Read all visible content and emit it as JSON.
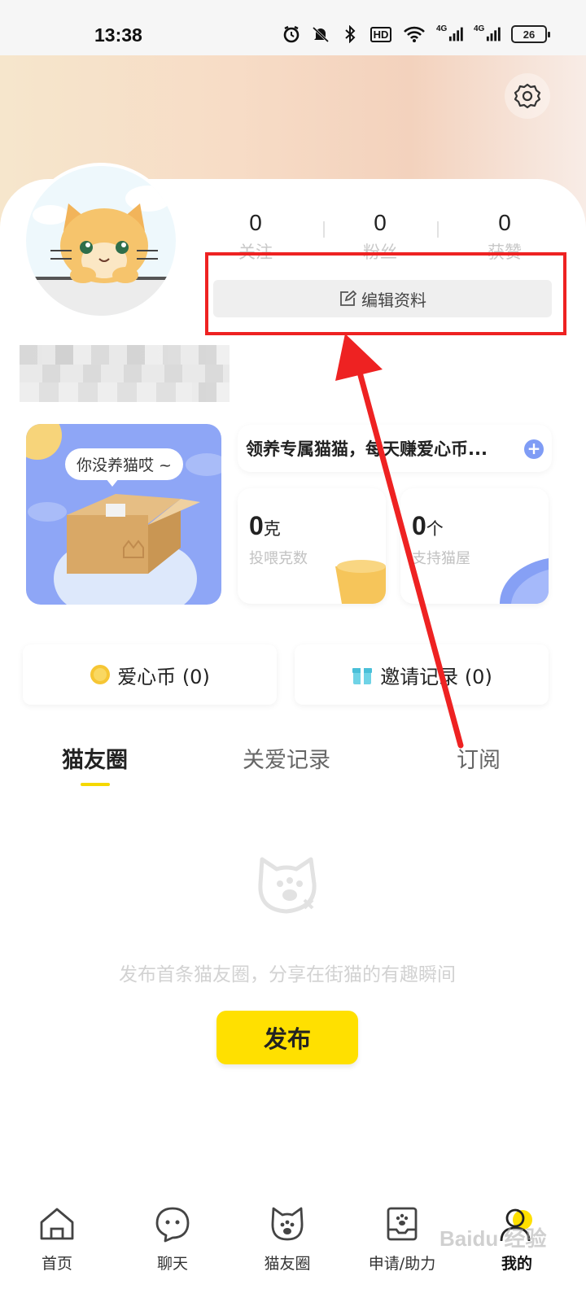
{
  "status_bar": {
    "time": "13:38",
    "hd_label": "HD",
    "net1_label": "4G",
    "net2_label": "4G",
    "battery_level": "26",
    "icons": [
      "alarm-icon",
      "mute-icon",
      "bluetooth-icon",
      "hd-icon",
      "wifi-icon",
      "signal-icon",
      "signal-icon",
      "battery-icon"
    ]
  },
  "profile": {
    "stats": [
      {
        "value": "0",
        "label": "关注"
      },
      {
        "value": "0",
        "label": "粉丝"
      },
      {
        "value": "0",
        "label": "获赞"
      }
    ],
    "edit_label": "编辑资料"
  },
  "adopt_card": {
    "bubble_text": "你没养猫哎 ~"
  },
  "promo": {
    "text": "领养专属猫猫，每天赚爱心币...",
    "add_symbol": "+"
  },
  "mini_cards": [
    {
      "value": "0",
      "unit": "克",
      "label": "投喂克数"
    },
    {
      "value": "0",
      "unit": "个",
      "label": "支持猫屋"
    }
  ],
  "wallet": {
    "coins_label": "爱心币 (0)",
    "invite_label": "邀请记录 (0)"
  },
  "tabs": [
    {
      "label": "猫友圈",
      "active": true
    },
    {
      "label": "关爱记录",
      "active": false
    },
    {
      "label": "订阅",
      "active": false
    }
  ],
  "empty_state": {
    "text": "发布首条猫友圈，分享在街猫的有趣瞬间",
    "publish_label": "发布"
  },
  "bottom_nav": [
    {
      "label": "首页",
      "icon": "home-icon"
    },
    {
      "label": "聊天",
      "icon": "chat-icon"
    },
    {
      "label": "猫友圈",
      "icon": "cat-circle-icon"
    },
    {
      "label": "申请/助力",
      "icon": "apply-icon"
    },
    {
      "label": "我的",
      "icon": "profile-icon",
      "active": true
    }
  ],
  "watermark": "Baidu 经验",
  "colors": {
    "accent_yellow": "#ffe000",
    "annotation_red": "#ee2222",
    "adopt_blue": "#8ea6f6"
  }
}
